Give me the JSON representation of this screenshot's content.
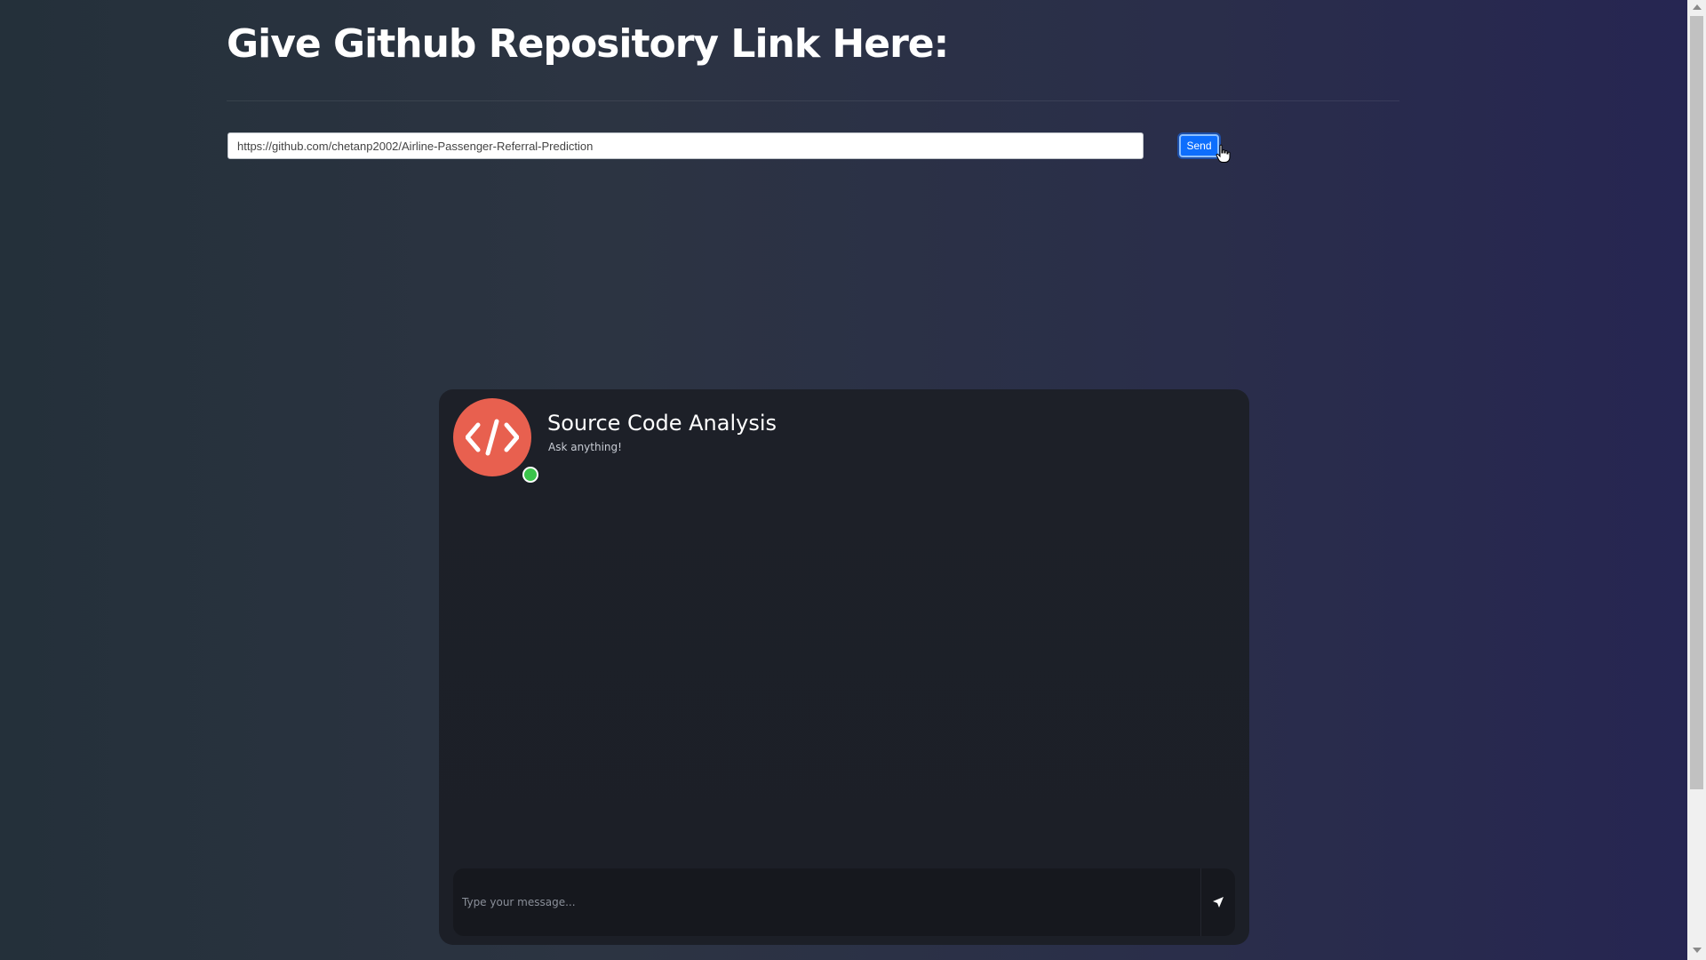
{
  "page": {
    "title": "Give Github Repository Link Here:"
  },
  "repo_form": {
    "input_value": "https://github.com/chetanp2002/Airline-Passenger-Referral-Prediction",
    "send_label": "Send"
  },
  "chat": {
    "title": "Source Code Analysis",
    "subtitle": "Ask anything!",
    "avatar_icon": "code-icon",
    "status": "online",
    "input_placeholder": "Type your message...",
    "send_icon": "paper-plane-icon"
  },
  "colors": {
    "accent": "#0d6efd",
    "avatar": "#e8604f",
    "online": "#3bc44b"
  }
}
